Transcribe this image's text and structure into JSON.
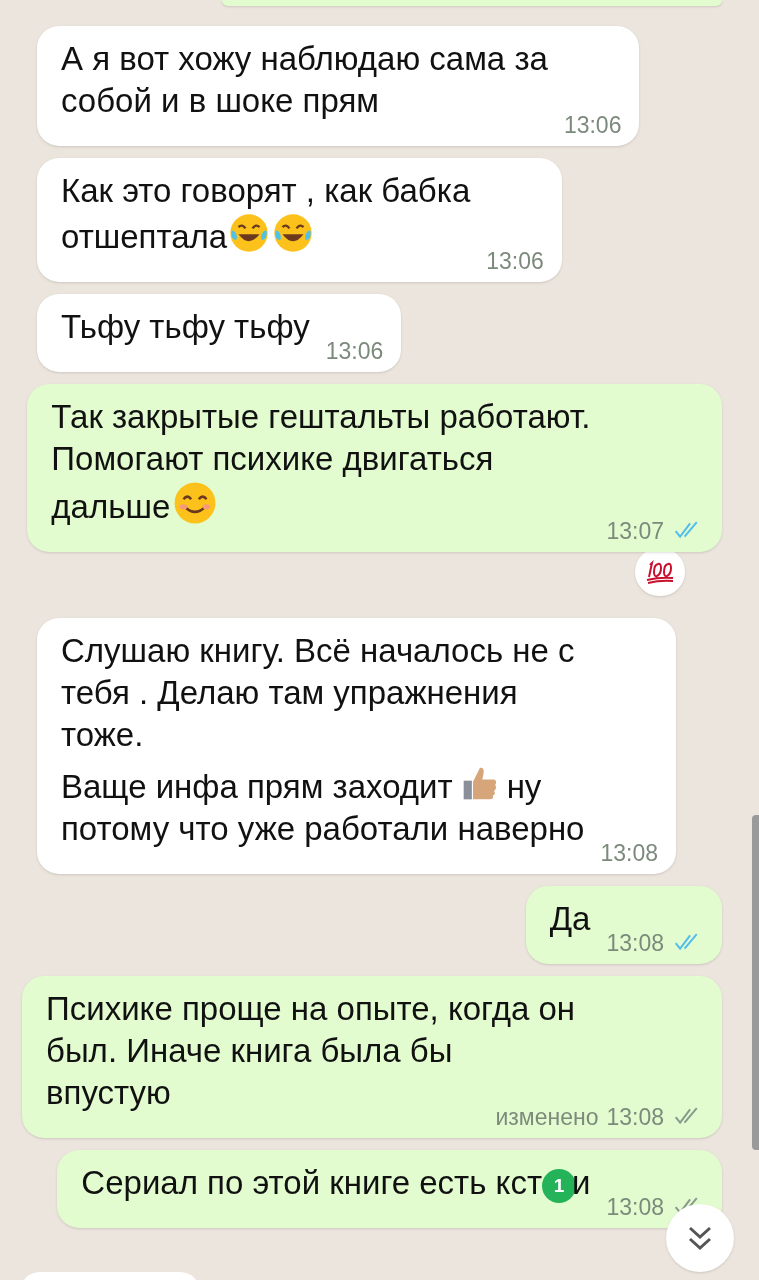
{
  "messages": [
    {
      "outgoing": false,
      "paragraphs": [
        [
          {
            "kind": "text",
            "text": "А я вот хожу наблюдаю сама за\nсобой и в шоке прям"
          }
        ]
      ],
      "time": "13:06"
    },
    {
      "outgoing": false,
      "paragraphs": [
        [
          {
            "kind": "text",
            "text": "Как это говорят , как бабка\nотшептала"
          },
          {
            "kind": "tears_joy"
          },
          {
            "kind": "tears_joy"
          }
        ]
      ],
      "time": "13:06"
    },
    {
      "outgoing": false,
      "paragraphs": [
        [
          {
            "kind": "text",
            "text": "Тьфу тьфу тьфу"
          }
        ]
      ],
      "time": "13:06"
    },
    {
      "outgoing": true,
      "paragraphs": [
        [
          {
            "kind": "text",
            "text": "Так закрытые гештальты работают.\nПомогают психике двигаться\nдальше"
          },
          {
            "kind": "smile"
          }
        ]
      ],
      "time": "13:07",
      "read": true,
      "reaction": {
        "kind": "hundred"
      }
    },
    {
      "outgoing": false,
      "paragraphs": [
        [
          {
            "kind": "text",
            "text": "Слушаю книгу. Всё началось не с\nтебя . Делаю там упражнения\nтоже."
          }
        ],
        [
          {
            "kind": "text",
            "text": "Ваще инфа прям заходит"
          },
          {
            "kind": "thumbs_up"
          },
          {
            "kind": "text",
            "text": "ну\nпотому что уже работали наверно"
          }
        ]
      ],
      "time": "13:08"
    },
    {
      "outgoing": true,
      "paragraphs": [
        [
          {
            "kind": "text",
            "text": "Да"
          }
        ]
      ],
      "time": "13:08",
      "read": true
    },
    {
      "outgoing": true,
      "paragraphs": [
        [
          {
            "kind": "text",
            "text": "Психике проще на опыте, когда он\nбыл. Иначе книга была бы\nвпустую"
          }
        ]
      ],
      "edited": "изменено",
      "time": "13:08",
      "read": false
    },
    {
      "outgoing": true,
      "paragraphs": [
        [
          {
            "kind": "text",
            "text": "Сериал по этой книге есть кст"
          },
          {
            "kind": "text",
            "text": "и"
          }
        ]
      ],
      "time": "13:08",
      "read": false
    }
  ],
  "unread_badge": "1"
}
